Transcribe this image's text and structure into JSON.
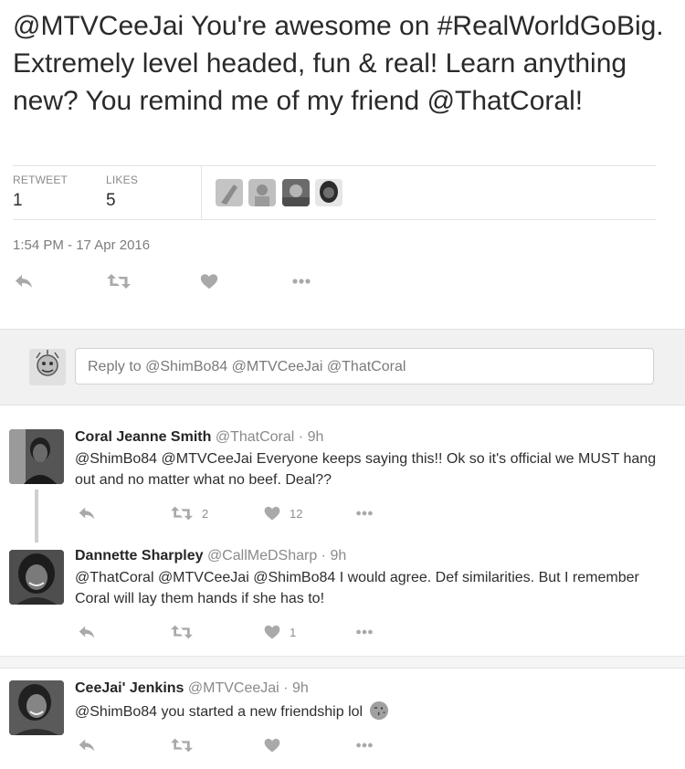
{
  "tweet": {
    "text": "@MTVCeeJai You're awesome on #RealWorldGoBig. Extremely level headed, fun & real! Learn anything new? You remind me of my friend @ThatCoral!",
    "retweet_label": "RETWEET",
    "retweet_count": "1",
    "likes_label": "LIKES",
    "likes_count": "5",
    "timestamp": "1:54 PM - 17 Apr 2016",
    "liker_avatars": [
      "avatar-1",
      "avatar-2",
      "avatar-3",
      "avatar-4"
    ]
  },
  "reply_box": {
    "placeholder": "Reply to @ShimBo84 @MTVCeeJai @ThatCoral"
  },
  "replies": [
    {
      "name": "Coral Jeanne Smith",
      "handle": "@ThatCoral",
      "time": "9h",
      "text": "@ShimBo84 @MTVCeeJai Everyone keeps saying this!! Ok so it's official we MUST hang out and no matter what no beef. Deal??",
      "retweets": "2",
      "likes": "12"
    },
    {
      "name": "Dannette Sharpley",
      "handle": "@CallMeDSharp",
      "time": "9h",
      "text": "@ThatCoral @MTVCeeJai @ShimBo84 I would agree.  Def similarities.  But I remember Coral will lay them hands if she has to!",
      "retweets": "",
      "likes": "1"
    },
    {
      "name": "CeeJai' Jenkins",
      "handle": "@MTVCeeJai",
      "time": "9h",
      "text": "@ShimBo84 you started a new friendship lol",
      "retweets": "",
      "likes": ""
    }
  ],
  "icons": {
    "reply": "reply-icon",
    "retweet": "retweet-icon",
    "like": "heart-icon",
    "more": "more-icon",
    "emoji": "kiss-face-emoji"
  },
  "colors": {
    "icon_gray": "#a9a9a9",
    "text": "#2a2a2a",
    "muted": "#8a8a8a",
    "band": "#f1f1f1"
  }
}
